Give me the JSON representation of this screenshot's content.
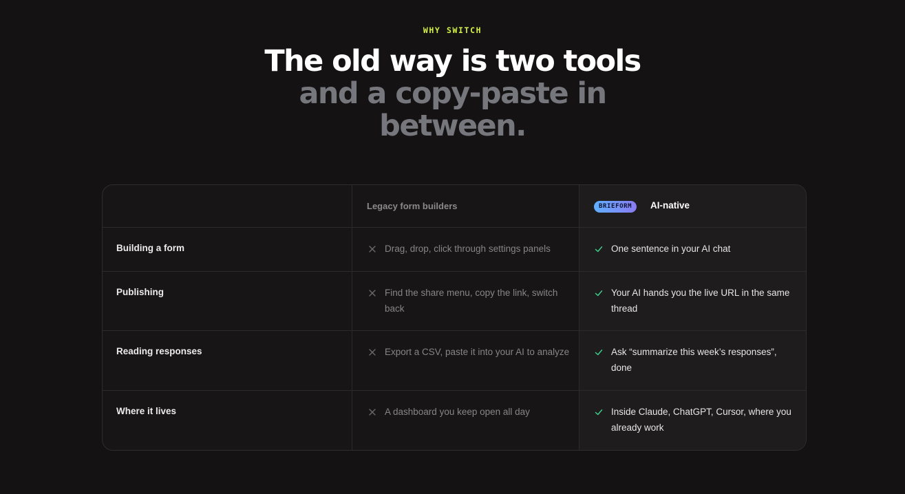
{
  "eyebrow": "WHY SWITCH",
  "headline": {
    "line1": "The old way is two tools",
    "line2": "and a copy-paste in",
    "line3": "between."
  },
  "colors": {
    "accent": "#d4f24a",
    "check": "#3ecf8e",
    "x_mark": "#6b6969",
    "muted_headline": "#76767d",
    "badge_gradient_start": "#5fb0ff",
    "badge_gradient_end": "#8a7bf2"
  },
  "table": {
    "headers": {
      "legacy": "Legacy form builders",
      "badge": "BRIEFORM",
      "ai": "AI-native"
    },
    "rows": [
      {
        "label": "Building a form",
        "legacy": "Drag, drop, click through settings panels",
        "ai": "One sentence in your AI chat"
      },
      {
        "label": "Publishing",
        "legacy": "Find the share menu, copy the link, switch back",
        "ai": "Your AI hands you the live URL in the same thread"
      },
      {
        "label": "Reading responses",
        "legacy": "Export a CSV, paste it into your AI to analyze",
        "ai": "Ask “summarize this week’s responses”, done"
      },
      {
        "label": "Where it lives",
        "legacy": "A dashboard you keep open all day",
        "ai": "Inside Claude, ChatGPT, Cursor, where you already work"
      }
    ],
    "icons": {
      "legacy": "x-icon",
      "ai": "check-icon"
    }
  }
}
